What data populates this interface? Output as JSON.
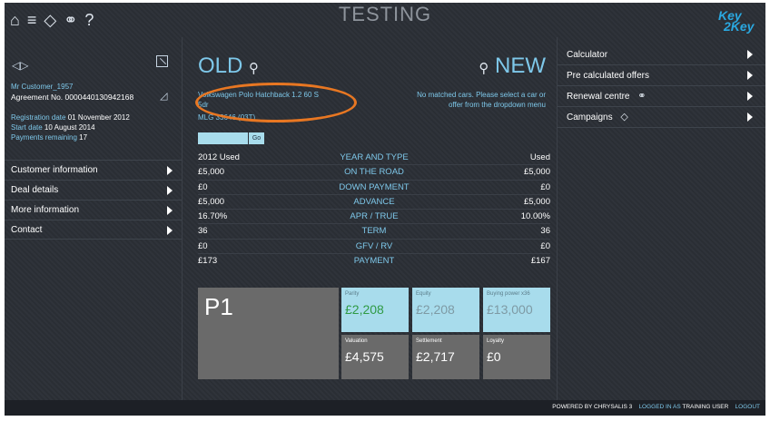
{
  "header": {
    "title": "TESTING",
    "icons": [
      "home-icon",
      "menu-icon",
      "tag-icon",
      "cars-icon",
      "help-icon"
    ],
    "logo": {
      "line1": "Key",
      "line2": "2Key"
    }
  },
  "left": {
    "nav_arrows": "◁▷",
    "customer_name": "Mr Customer_1957",
    "agreement_label": "Agreement No.",
    "agreement_no": "0000440130942168",
    "registration_label": "Registration date",
    "registration_date": "01 November 2012",
    "start_label": "Start date",
    "start_date": "10 August 2014",
    "payments_label": "Payments remaining",
    "payments_remaining": "17",
    "menu": [
      {
        "label": "Customer information"
      },
      {
        "label": "Deal details"
      },
      {
        "label": "More information"
      },
      {
        "label": "Contact"
      }
    ]
  },
  "middle": {
    "old_label": "OLD",
    "new_label": "NEW",
    "old_car_line1": "Volkswagen Polo Hatchback 1.2 60 S",
    "old_car_line2": "5dr",
    "old_reg": "MLG 33646 (03T)",
    "new_message_line1": "No matched cars. Please select a car or",
    "new_message_line2": "offer from the dropdown menu",
    "go_label": "Go",
    "rows": [
      {
        "old": "2012 Used",
        "label": "YEAR AND TYPE",
        "new": "Used"
      },
      {
        "old": "£5,000",
        "label": "ON THE ROAD",
        "new": "£5,000"
      },
      {
        "old": "£0",
        "label": "DOWN PAYMENT",
        "new": "£0"
      },
      {
        "old": "£5,000",
        "label": "ADVANCE",
        "new": "£5,000"
      },
      {
        "old": "16.70%",
        "label": "APR / TRUE",
        "new": "10.00%"
      },
      {
        "old": "36",
        "label": "TERM",
        "new": "36"
      },
      {
        "old": "£0",
        "label": "GFV / RV",
        "new": "£0"
      },
      {
        "old": "£173",
        "label": "PAYMENT",
        "new": "£167"
      }
    ],
    "tiles": {
      "p1": "P1",
      "parity": {
        "label": "Parity",
        "value": "£2,208"
      },
      "equity": {
        "label": "Equity",
        "value": "£2,208"
      },
      "buying_power": {
        "label": "Buying power x36",
        "value": "£13,000"
      },
      "valuation": {
        "label": "Valuation",
        "value": "£4,575"
      },
      "settlement": {
        "label": "Settlement",
        "value": "£2,717"
      },
      "loyalty": {
        "label": "Loyalty",
        "value": "£0"
      }
    }
  },
  "right": {
    "menu": [
      {
        "label": "Calculator"
      },
      {
        "label": "Pre calculated offers"
      },
      {
        "label": "Renewal centre"
      },
      {
        "label": "Campaigns"
      }
    ]
  },
  "footer": {
    "powered_by": "POWERED BY CHRYSALIS 3",
    "logged_in_as": "LOGGED IN AS",
    "user": "TRAINING USER",
    "logout": "LOGOUT"
  },
  "colors": {
    "accent": "#7ec8ea",
    "highlight_ring": "#e87722",
    "tile_light": "#a8dcec",
    "tile_dark": "#6a6a6a",
    "parity_green": "#2f9a44"
  }
}
